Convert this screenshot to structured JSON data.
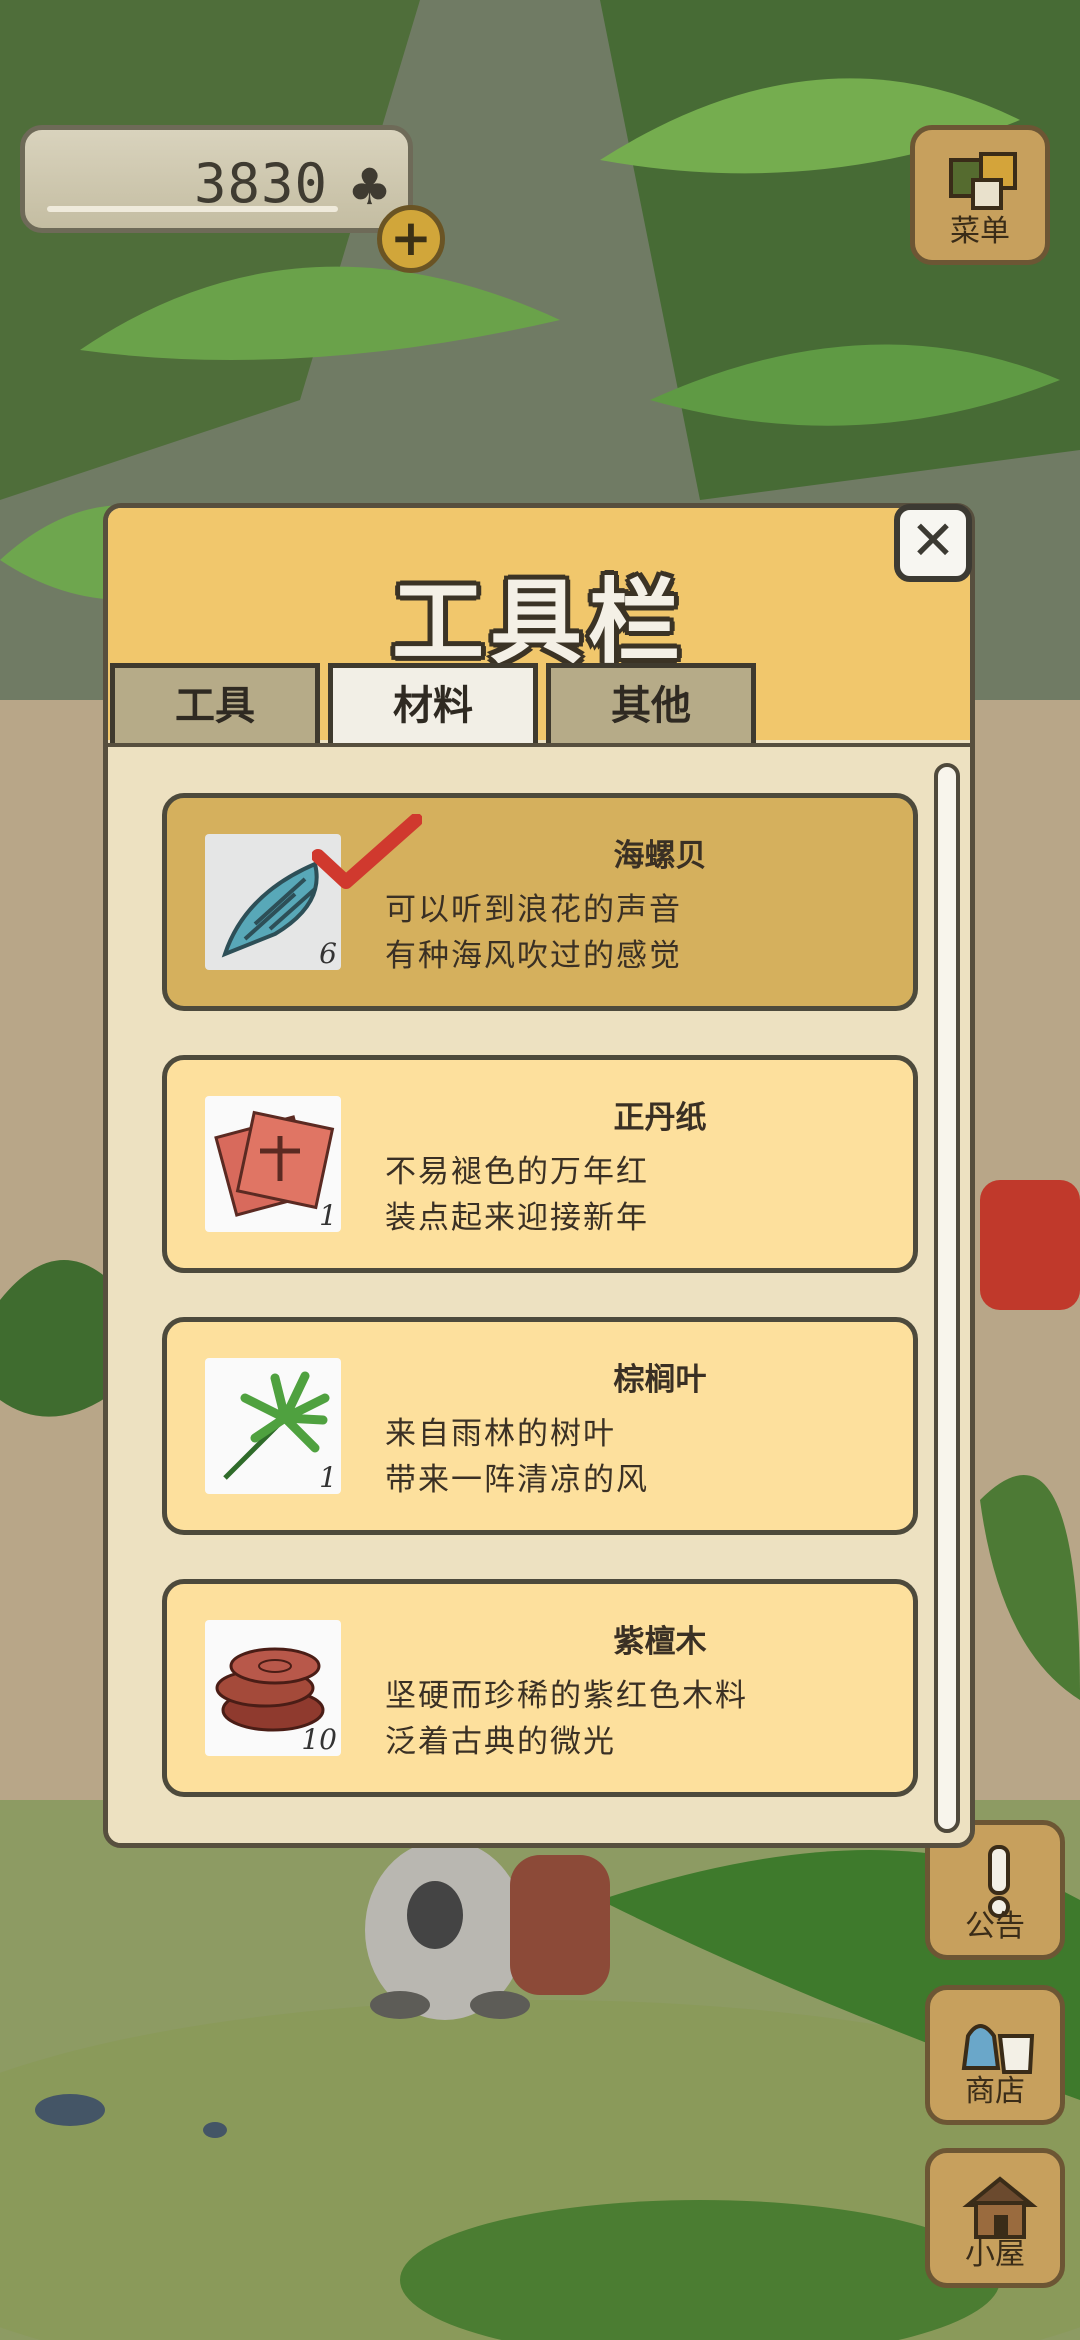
{
  "currency": {
    "amount": "3830",
    "icon": "clover-icon"
  },
  "menu": {
    "label": "菜单"
  },
  "panel": {
    "title": "工具栏",
    "tabs": [
      {
        "label": "工具",
        "active": false
      },
      {
        "label": "材料",
        "active": true
      },
      {
        "label": "其他",
        "active": false
      }
    ],
    "items": [
      {
        "name": "海螺贝",
        "line1": "可以听到浪花的声音",
        "line2": "有种海风吹过的感觉",
        "count": "6",
        "selected": true,
        "icon": "seashell-icon"
      },
      {
        "name": "正丹纸",
        "line1": "不易褪色的万年红",
        "line2": "装点起来迎接新年",
        "count": "1",
        "selected": false,
        "icon": "red-paper-icon"
      },
      {
        "name": "棕榈叶",
        "line1": "来自雨林的树叶",
        "line2": "带来一阵清凉的风",
        "count": "1",
        "selected": false,
        "icon": "palm-leaf-icon"
      },
      {
        "name": "紫檀木",
        "line1": "坚硬而珍稀的紫红色木料",
        "line2": "泛着古典的微光",
        "count": "10",
        "selected": false,
        "icon": "wood-slices-icon"
      }
    ]
  },
  "side_buttons": {
    "notice": "公告",
    "shop": "商店",
    "house": "小屋"
  }
}
